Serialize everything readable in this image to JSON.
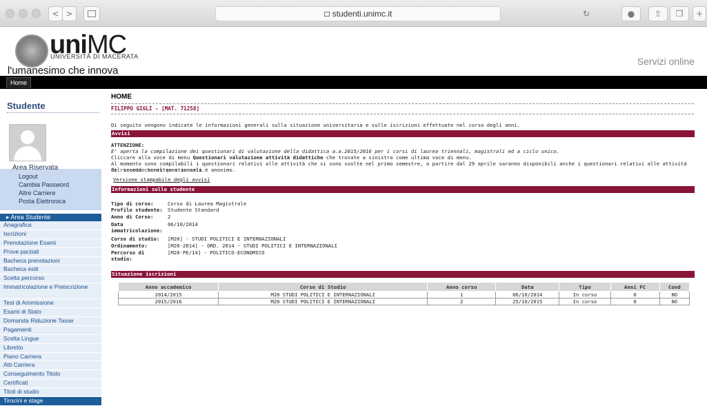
{
  "browser": {
    "url": "studenti.unimc.it",
    "back": "<",
    "forward": ">"
  },
  "header": {
    "brand_bold": "uni",
    "brand_light": "MC",
    "brand_sub": "UNIVERSITÀ DI MACERATA",
    "tagline": "l'umanesimo che innova",
    "servizi": "Servizi online",
    "home_tab": "Home"
  },
  "sidebar": {
    "title": "Studente",
    "reserved_head": "Area Riservata",
    "reserved_items": [
      "Logout",
      "Cambia Password",
      "Altre Carriere",
      "Posta Elettronica"
    ],
    "menu_head": "Area Studente",
    "menu_items": [
      "Anagrafica",
      "Iscrizioni",
      "Prenotazione Esami",
      "Prove parziali",
      "Bacheca prenotazioni",
      "Bacheca esiti",
      "Scelta percorso",
      "Immatricolazione e Preiscrizione",
      "Test di Ammissione",
      "Esami di Stato",
      "Domanda Riduzione Tasse",
      "Pagamenti",
      "Scelta Lingue",
      "Libretto",
      "Piano Carriera",
      "Atti Carriera",
      "Conseguimento Titolo",
      "Certificati",
      "Titoli di studio"
    ],
    "menu_partial": "Tirocini e stage"
  },
  "main": {
    "title": "HOME",
    "student": "FILIPPO GIGLI - [MAT. 71258]",
    "intro": "Di seguito vengono indicate le informazioni generali sulla situazione universitaria e sulle iscrizioni effettuate nel corso degli anni.",
    "avvisi_title": "Avvisi",
    "attenzione": "ATTENZIONE:",
    "avviso_1": "E' aperta la compilazione dei questionari di valutazione della didattica a.a.2015/2016 per i corsi di laurea triennali, magistrali ed a ciclo unico.",
    "avviso_2a": "Cliccare alla voce di menu ",
    "avviso_2b": "Questionari valutazione attività didattiche",
    "avviso_2c": " che trovate a sinistra come ultima voce di menu.",
    "avviso_3": "Al momento sono compilabili i questionari relativi alle attività che si sono svolte nel primo semestre, a partire dal 29 aprile saranno disponibili anche i questionari relativi alle attività del secondo semestre e annuali.",
    "avviso_4": "Si ricorda che il questionario è anonimo.",
    "print_link": "Versione stampabile degli avvisi",
    "info_title": "Informazioni sullo studente",
    "info": [
      {
        "label": "Tipo di corso:",
        "value": "Corso di Laurea Magistrale"
      },
      {
        "label": "Profilo studente:",
        "value": "Studente Standard"
      },
      {
        "label": "Anno di Corso:",
        "value": "2"
      },
      {
        "label": "Data immatricolazione:",
        "value": "06/10/2014"
      },
      {
        "label": "Corso di studio:",
        "value": "[M20] - STUDI POLITICI E INTERNAZIONALI"
      },
      {
        "label": "Ordinamento:",
        "value": "[M20-2014] - ORD. 2014 - STUDI POLITICI E INTERNAZIONALI"
      },
      {
        "label": "Percorso di studio:",
        "value": "[M20-PE/14] - POLITICO-ECONOMICO"
      }
    ],
    "iscr_title": "Situazione iscrizioni",
    "table": {
      "headers": [
        "Anno accademico",
        "Corso di Studio",
        "Anno corso",
        "Data",
        "Tipo",
        "Anni FC",
        "Cond"
      ],
      "rows": [
        [
          "2014/2015",
          "M20 STUDI POLITICI E INTERNAZIONALI",
          "1",
          "06/10/2014",
          "In corso",
          "0",
          "NO"
        ],
        [
          "2015/2016",
          "M20 STUDI POLITICI E INTERNAZIONALI",
          "2",
          "25/10/2015",
          "In corso",
          "0",
          "NO"
        ]
      ]
    }
  },
  "colors": {
    "accent": "#8a1338",
    "sidebar_blue": "#1d5d9a",
    "light_blue": "#c9daf0"
  }
}
